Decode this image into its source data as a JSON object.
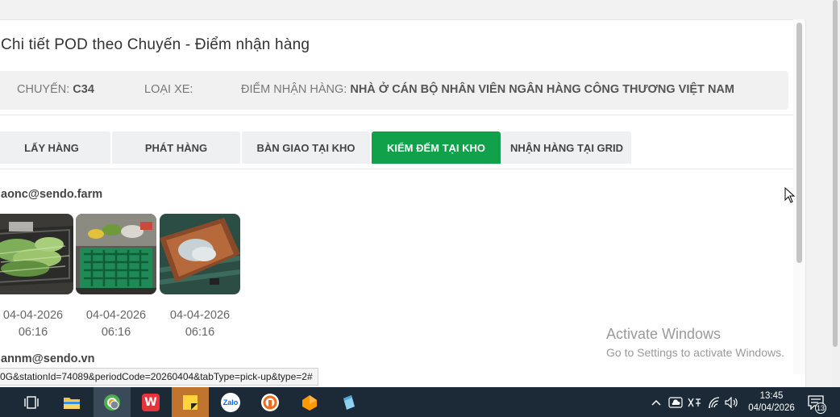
{
  "modal": {
    "title": "Chi tiết POD theo Chuyến - Điểm nhận hàng",
    "info": {
      "trip_label": "CHUYẾN:",
      "trip_value": "C34",
      "vehicle_label": "LOẠI XE:",
      "vehicle_value": "",
      "pickup_label": "ĐIỂM NHẬN HÀNG:",
      "pickup_value": "NHÀ Ở CÁN BỘ NHÂN VIÊN NGÂN HÀNG CÔNG THƯƠNG VIỆT NAM"
    },
    "tabs": [
      {
        "label": "LẤY HÀNG",
        "active": false
      },
      {
        "label": "PHÁT HÀNG",
        "active": false
      },
      {
        "label": "BÀN GIAO TẠI KHO",
        "active": false
      },
      {
        "label": "KIỂM ĐẾM TẠI KHO",
        "active": true
      },
      {
        "label": "NHẬN HÀNG TẠI GRID",
        "active": false
      }
    ],
    "sections": [
      {
        "email": "aonc@sendo.farm",
        "photos": [
          {
            "date": "04-04-2026",
            "time": "06:16",
            "icon": "vegetables-photo"
          },
          {
            "date": "04-04-2026",
            "time": "06:16",
            "icon": "crate-photo"
          },
          {
            "date": "04-04-2026",
            "time": "06:16",
            "icon": "box-photo"
          }
        ]
      },
      {
        "email": "annm@sendo.vn"
      }
    ]
  },
  "status_url": "0G&stationId=74089&periodCode=20260404&tabType=pick-up&type=2#",
  "watermark": {
    "title": "Activate Windows",
    "subtitle": "Go to Settings to activate Windows."
  },
  "taskbar": {
    "apps": [
      "task-view-icon",
      "file-explorer-icon",
      "browser-icon",
      "wps-icon",
      "sticky-notes-icon",
      "zalo-icon",
      "orbit-icon",
      "sublime-icon",
      "notes-app-icon"
    ],
    "zalo_label": "Zalo",
    "wps_label": "W",
    "clock_time": "13:45",
    "clock_date": "04/04/2026",
    "notification_count": "13"
  },
  "colors": {
    "accent": "#10a14a",
    "taskbar": "#1c2a37"
  }
}
